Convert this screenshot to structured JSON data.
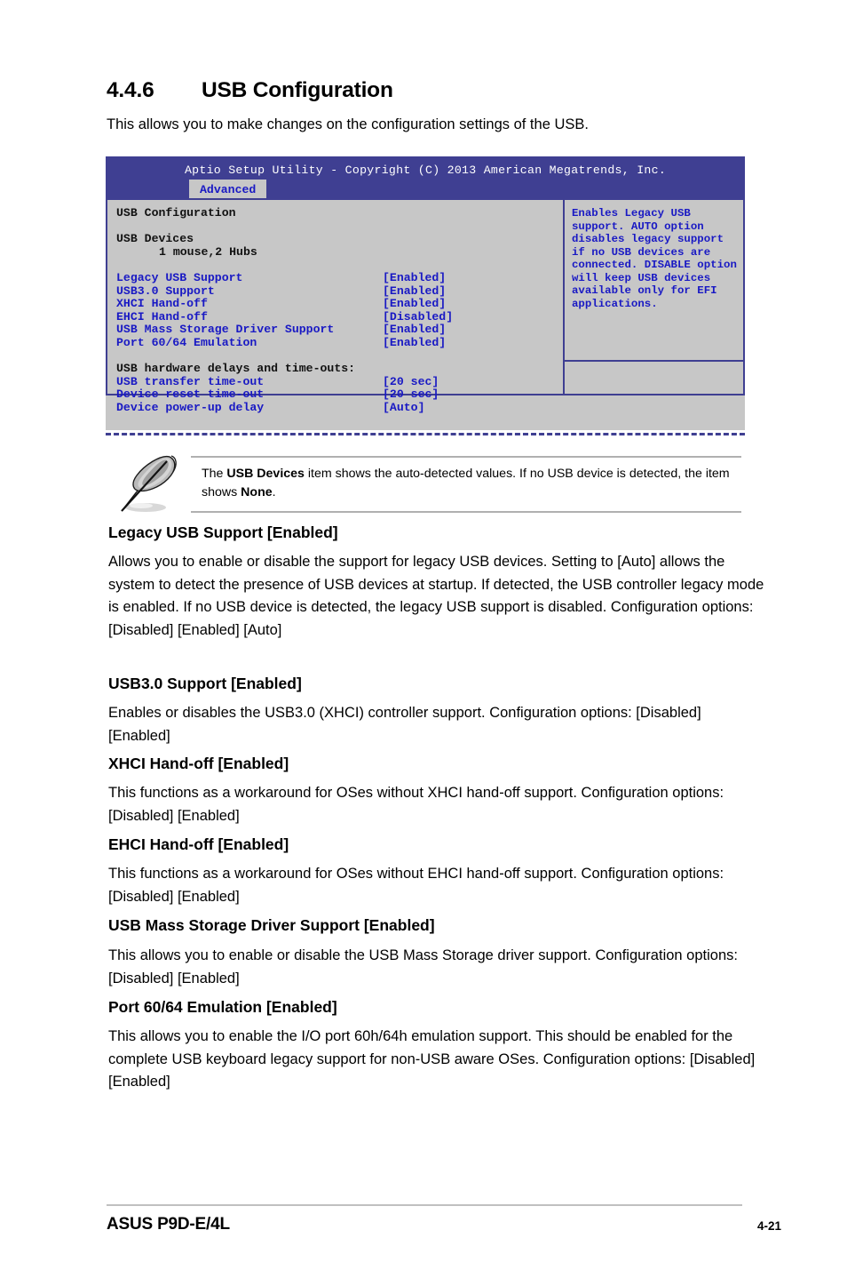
{
  "section": {
    "number": "4.4.6",
    "title": "USB Configuration",
    "intro": "This allows you to make changes on the configuration settings of the USB."
  },
  "bios": {
    "titlebar": "Aptio Setup Utility - Copyright (C) 2013 American Megatrends, Inc.",
    "active_tab": "Advanced",
    "screen_title": "USB Configuration",
    "devices_label": "USB Devices",
    "devices_value": "1 mouse,2 Hubs",
    "items": [
      {
        "label": "Legacy USB Support",
        "value": "[Enabled]"
      },
      {
        "label": "USB3.0 Support",
        "value": "[Enabled]"
      },
      {
        "label": "XHCI Hand-off",
        "value": "[Enabled]"
      },
      {
        "label": "EHCI Hand-off",
        "value": "[Disabled]"
      },
      {
        "label": "USB Mass Storage Driver Support",
        "value": "[Enabled]"
      },
      {
        "label": "Port 60/64 Emulation",
        "value": "[Enabled]"
      }
    ],
    "delays_header": "USB hardware delays and time-outs:",
    "delay_items": [
      {
        "label": "USB transfer time-out",
        "value": "[20 sec]"
      },
      {
        "label": "Device reset time-out",
        "value": "[20 sec]"
      },
      {
        "label": "Device power-up delay",
        "value": "[Auto]"
      }
    ],
    "help_text": "Enables Legacy USB support. AUTO option disables legacy support if no USB devices are connected. DISABLE option will keep USB devices available only for EFI applications.",
    "colors": {
      "titlebar_bg": "#3f3f92",
      "screen_bg": "#c7c7c7",
      "border": "#3f3f92",
      "item_text": "#1919c4",
      "static_text": "#111111"
    }
  },
  "note": {
    "icon": "quill-pen-icon",
    "text_before": "The ",
    "bold_1": "USB Devices",
    "text_middle": " item shows the auto-detected values. If no USB device is detected, the item shows ",
    "bold_2": "None",
    "text_after": "."
  },
  "sections": [
    {
      "heading": "Legacy USB Support [Enabled]",
      "body": "Allows you to enable or disable the support for legacy USB devices. Setting to [Auto] allows the system to detect the presence of USB devices at startup. If detected, the USB controller legacy mode is enabled. If no USB device is detected, the legacy USB support is disabled. Configuration options: [Disabled] [Enabled] [Auto]"
    },
    {
      "heading": "USB3.0 Support [Enabled]",
      "body": "Enables or disables the USB3.0 (XHCI) controller support. Configuration options: [Disabled] [Enabled]"
    },
    {
      "heading": "XHCI Hand-off [Enabled]",
      "body": "This functions as a workaround for OSes without XHCI hand-off support. Configuration options: [Disabled] [Enabled]"
    },
    {
      "heading": "EHCI Hand-off [Enabled]",
      "body": "This functions as a workaround for OSes without EHCI hand-off support. Configuration options: [Disabled] [Enabled]"
    },
    {
      "heading": "USB Mass Storage Driver Support [Enabled]",
      "body": "This allows you to enable or disable the USB Mass Storage driver support. Configuration options: [Disabled] [Enabled]"
    },
    {
      "heading": "Port 60/64 Emulation [Enabled]",
      "body": "This allows you to enable the I/O port 60h/64h emulation support. This should be enabled for the complete USB keyboard legacy support for non-USB aware OSes. Configuration options: [Disabled] [Enabled]"
    }
  ],
  "footer": {
    "left": "ASUS P9D-E/4L",
    "right": "4-21"
  }
}
